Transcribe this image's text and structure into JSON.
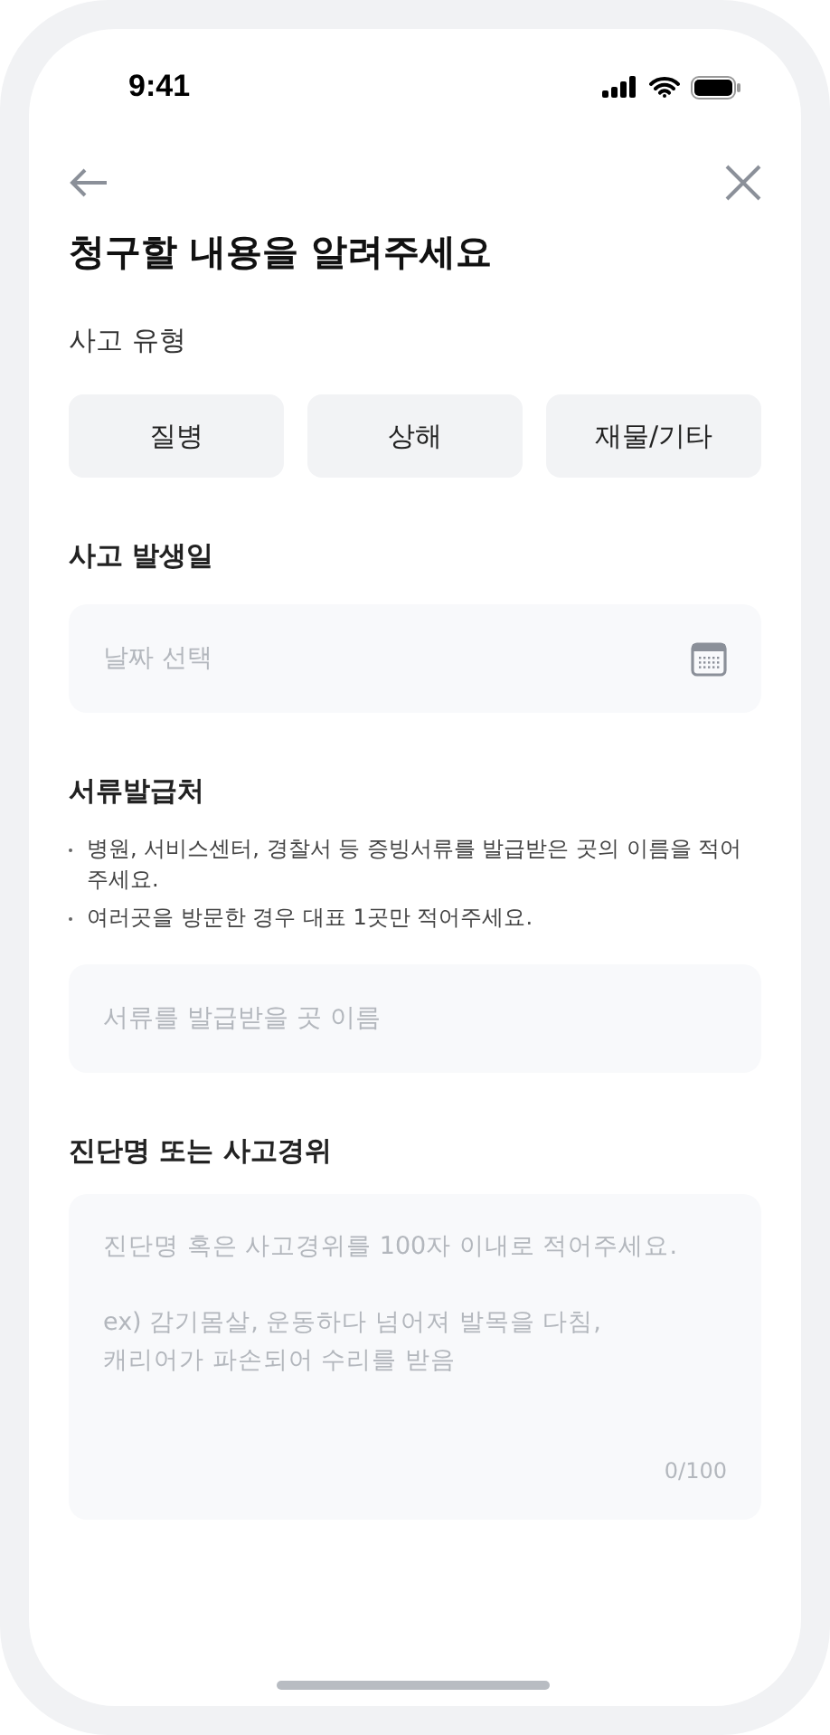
{
  "status_bar": {
    "time": "9:41"
  },
  "title": "청구할 내용을 알려주세요",
  "accident_type": {
    "label": "사고 유형",
    "options": [
      {
        "label": "질병",
        "selected": false
      },
      {
        "label": "상해",
        "selected": false
      },
      {
        "label": "재물/기타",
        "selected": false
      }
    ]
  },
  "accident_date": {
    "label": "사고 발생일",
    "placeholder": "날짜 선택"
  },
  "issuer": {
    "label": "서류발급처",
    "notes": [
      "병원, 서비스센터, 경찰서 등 증빙서류를 발급받은 곳의 이름을 적어주세요.",
      "여러곳을 방문한 경우 대표 1곳만 적어주세요."
    ],
    "placeholder": "서류를 발급받을 곳 이름"
  },
  "description": {
    "label": "진단명 또는 사고경위",
    "placeholder": "진단명 혹은 사고경위를 100자 이내로 적어주세요.\n\nex) 감기몸살, 운동하다 넘어져 발목을 다침,\n캐리어가 파손되어 수리를 받음",
    "counter": "0/100"
  }
}
